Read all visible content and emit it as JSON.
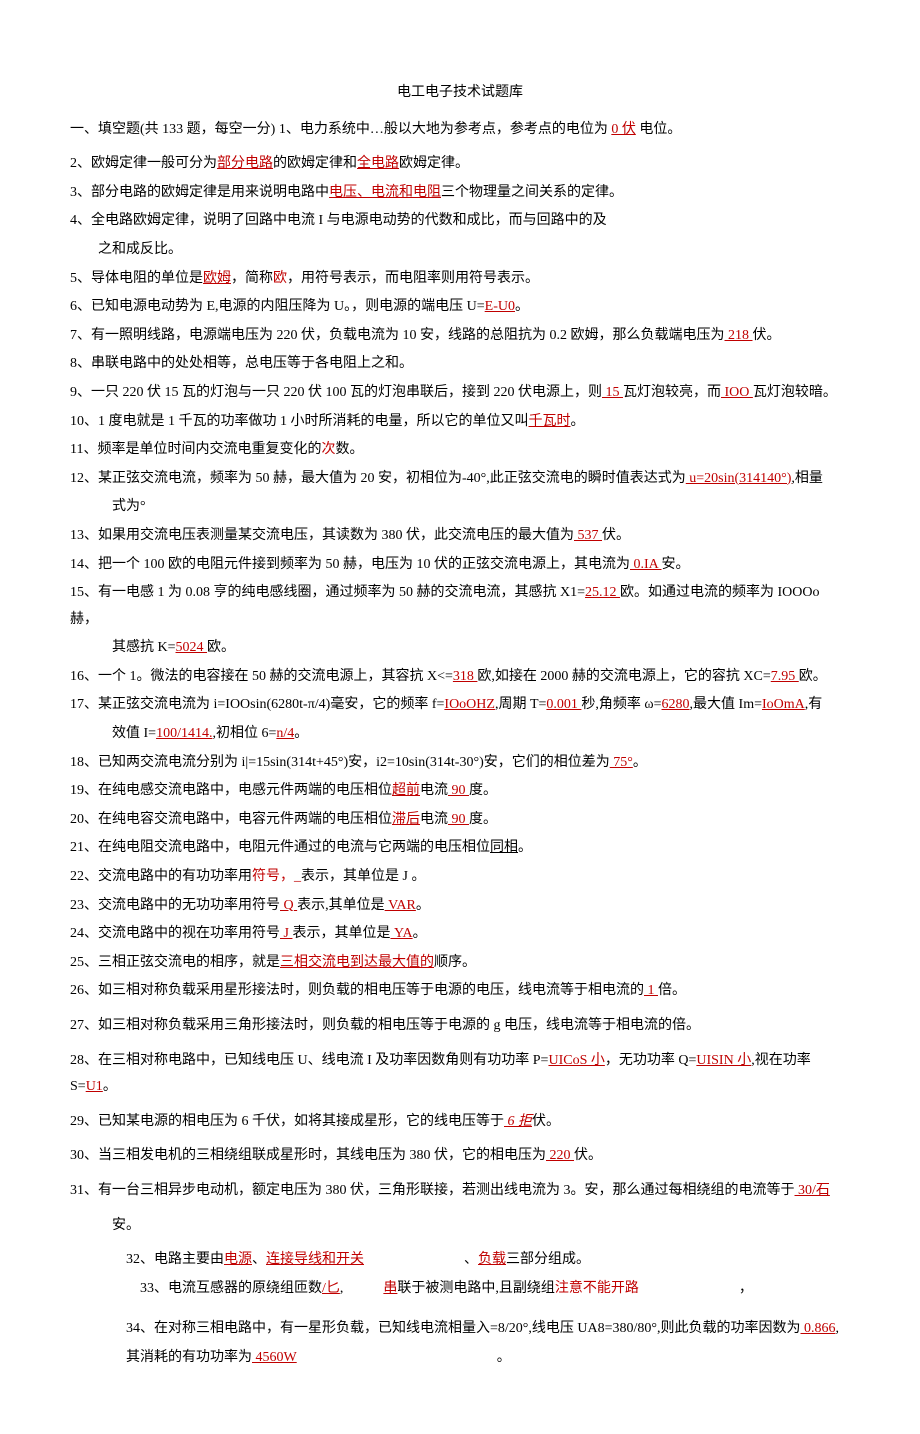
{
  "title": "电工电子技术试题库",
  "section_header": "一、填空题(共 133 题，每空一分) 1、电力系统中…般以大地为参考点，参考点的电位为",
  "section_header_ans": "0 伏",
  "section_header_tail": "电位。",
  "q2_pre": "2、欧姆定律一般可分为",
  "q2_a1": "部分电路",
  "q2_mid1": "的欧姆定律和",
  "q2_a2": "全电路",
  "q2_tail": "欧姆定律。",
  "q3_pre": "3、部分电路的欧姆定律是用来说明电路中",
  "q3_a1": "电压、电流和电阻",
  "q3_tail": "三个物理量之间关系的定律。",
  "q4_line1": "4、全电路欧姆定律，说明了回路中电流 I 与电源电动势的代数和成比，而与回路中的及",
  "q4_line2": "之和成反比。",
  "q5_pre": "5、导体电阻的单位是",
  "q5_a1": "欧姆",
  "q5_mid": "，简称",
  "q5_a2": "欧",
  "q5_tail": "，用符号表示，而电阻率则用符号表示。",
  "q6_pre": "6、已知电源电动势为 E,电源的内阻压降为 U。，则电源的端电压 U=",
  "q6_a1": "E-U0",
  "q6_tail": "。",
  "q7_pre": "7、有一照明线路，电源端电压为 220 伏，负载电流为 10 安，线路的总阻抗为 0.2 欧姆，那么负载端电压为",
  "q7_a1": " 218 ",
  "q7_tail": "伏。",
  "q8": "8、串联电路中的处处相等，总电压等于各电阻上之和。",
  "q9_pre": "9、一只 220 伏 15 瓦的灯泡与一只 220 伏 100 瓦的灯泡串联后，接到 220 伏电源上，则",
  "q9_a1": " 15 ",
  "q9_mid1": "瓦灯泡较亮，而",
  "q9_a2": " IOO ",
  "q9_tail": "瓦灯泡较暗。",
  "q10_pre": "10、1 度电就是 1 千瓦的功率做功 1 小时所消耗的电量，所以它的单位又叫",
  "q10_a1": "千瓦时",
  "q10_tail": "。",
  "q11_pre": "11、频率是单位时间内交流电重复变化的",
  "q11_a1": "次",
  "q11_tail": "数。",
  "q12_pre": "12、某正弦交流电流，频率为 50 赫，最大值为 20 安，初相位为-40°,此正弦交流电的瞬时值表达式为",
  "q12_a1": " u=20sin(314140°)",
  "q12_tail": ",相量",
  "q12_line2": "式为°",
  "q13_pre": "13、如果用交流电压表测量某交流电压，其读数为 380 伏，此交流电压的最大值为",
  "q13_a1": " 537 ",
  "q13_tail": "伏。",
  "q14_pre": "14、把一个 100 欧的电阻元件接到频率为 50 赫，电压为 10 伏的正弦交流电源上，其电流为",
  "q14_a1": " 0.IA ",
  "q14_tail": "安。",
  "q15_pre": "15、有一电感 1 为 0.08 亨的纯电感线圈，通过频率为 50 赫的交流电流，其感抗 X1=",
  "q15_a1": "25.12 ",
  "q15_tail": "欧。如通过电流的频率为 IOOOo 赫，",
  "q15_line2_pre": "其感抗 K=",
  "q15_line2_a1": "5024 ",
  "q15_line2_tail": "欧。",
  "q16_pre": "16、一个 1。微法的电容接在 50 赫的交流电源上，其容抗 X<=",
  "q16_a1": "318 ",
  "q16_mid": "欧,如接在 2000 赫的交流电源上，它的容抗 XC=",
  "q16_a2": "7.95 ",
  "q16_tail": "欧。",
  "q17_pre": "17、某正弦交流电流为 i=IOOsin(6280t-π/4)毫安，它的频率 f=",
  "q17_a1": "IOoOHZ",
  "q17_m1": ",周期 T=",
  "q17_a2": "0.001 ",
  "q17_m2": "秒,角频率 ω=",
  "q17_a3": "6280",
  "q17_m3": ",最大值 Im=",
  "q17_a4": "IoOmA",
  "q17_tail": ",有",
  "q17_line2_pre": "效值 I=",
  "q17_line2_a1": "100/1414.",
  "q17_line2_mid": ",初相位 6=",
  "q17_line2_a2": "n/4",
  "q17_line2_tail": "。",
  "q18_pre": "18、已知两交流电流分别为 i|=15sin(314t+45°)安，i2=10sin(314t-30°)安，它们的相位差为",
  "q18_a1": " 75°",
  "q18_tail": "。",
  "q19_pre": "19、在纯电感交流电路中，电感元件两端的电压相位",
  "q19_a1": "超前",
  "q19_mid": "电流",
  "q19_a2": " 90 ",
  "q19_tail": "度。",
  "q20_pre": "20、在纯电容交流电路中，电容元件两端的电压相位",
  "q20_a1": "滞后",
  "q20_mid": "电流",
  "q20_a2": " 90 ",
  "q20_tail": "度。",
  "q21_pre": "21、在纯电阻交流电路中，电阻元件通过的电流与它两端的电压相位",
  "q21_u": "同相",
  "q21_tail": "。",
  "q22_pre": "22、交流电路中的有功功率用",
  "q22_a1": "符号，_",
  "q22_tail": "表示，其单位是 J 。",
  "q23_pre": "23、交流电路中的无功功率用符号",
  "q23_a1": " Q ",
  "q23_mid": "表示,其单位是",
  "q23_a2": " VAR",
  "q23_tail": "。",
  "q24_pre": "24、交流电路中的视在功率用符号",
  "q24_a1": " J ",
  "q24_mid": "表示，其单位是",
  "q24_a2": " YA",
  "q24_tail": "。",
  "q25_pre": "25、三相正弦交流电的相序，就是",
  "q25_a1": "三相交流电到达最大值的",
  "q25_tail": "顺序。",
  "q26_pre": "26、如三相对称负载采用星形接法时，则负载的相电压等于电源的电压，线电流等于相电流的",
  "q26_a1": " 1 ",
  "q26_tail": "倍。",
  "q27": "27、如三相对称负载采用三角形接法时，则负载的相电压等于电源的 g 电压，线电流等于相电流的倍。",
  "q28_pre": "28、在三相对称电路中，已知线电压 U、线电流 I 及功率因数角则有功功率 P=",
  "q28_a1": "UICoS 小",
  "q28_mid1": "，无功功率 Q=",
  "q28_a2": "UISIN 小",
  "q28_mid2": ",视在功率 S=",
  "q28_a3": "U1",
  "q28_tail": "。",
  "q29_pre": "29、已知某电源的相电压为 6 千伏，如将其接成星形，它的线电压等于",
  "q29_a1": " 6 拒",
  "q29_tail": "伏。",
  "q30_pre": "30、当三相发电机的三相绕组联成星形时，其线电压为 380 伏，它的相电压为",
  "q30_a1": " 220 ",
  "q30_tail": "伏。",
  "q31_pre": "31、有一台三相异步电动机，额定电压为 380 伏，三角形联接，若测出线电流为 3。安，那么通过每相绕组的电流等于",
  "q31_a1": " 30/石",
  "q31_line2": "安。",
  "q32_pre": "32、电路主要由",
  "q32_a1": "电源",
  "q32_sep1": "、",
  "q32_a2": "连接导线和开关",
  "q32_sep2": "、",
  "q32_a3": "负载",
  "q32_tail": "三部分组成。",
  "q33_pre": "33、电流互感器的原绕组匝数",
  "q33_a1": "/匕",
  "q33_sep": ",",
  "q33_a2": "串",
  "q33_mid": "联于被测电路中,且副绕组",
  "q33_a3": "注意不能开路",
  "q33_tail": "，",
  "q34_pre": "34、在对称三相电路中，有一星形负载，已知线电流相量入=8/20°,线电压 UA8=380/80°,则此负载的功率因数为",
  "q34_a1": " 0.866",
  "q34_tail": ",",
  "q34_line2_pre": "其消耗的有功功率为",
  "q34_line2_a1": " 4560W",
  "q34_line2_tail": "。"
}
